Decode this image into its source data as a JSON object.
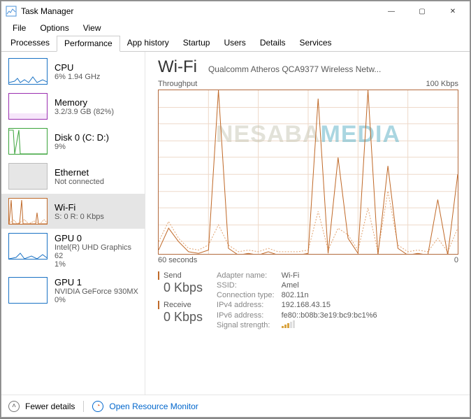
{
  "window": {
    "title": "Task Manager",
    "controls": {
      "min": "—",
      "max": "▢",
      "close": "✕"
    }
  },
  "menu": [
    "File",
    "Options",
    "View"
  ],
  "tabs": [
    "Processes",
    "Performance",
    "App history",
    "Startup",
    "Users",
    "Details",
    "Services"
  ],
  "activeTab": 1,
  "sidebar": [
    {
      "name": "CPU",
      "sub": "6%  1.94 GHz",
      "color": "#1a72c4"
    },
    {
      "name": "Memory",
      "sub": "3.2/3.9 GB (82%)",
      "color": "#9b2fb0"
    },
    {
      "name": "Disk 0 (C: D:)",
      "sub": "9%",
      "color": "#3aa33a"
    },
    {
      "name": "Ethernet",
      "sub": "Not connected",
      "color": "#bdbdbd"
    },
    {
      "name": "Wi-Fi",
      "sub": "S: 0 R: 0 Kbps",
      "color": "#c06a2a",
      "selected": true
    },
    {
      "name": "GPU 0",
      "sub": "Intel(R) UHD Graphics 62\n1%",
      "color": "#1a72c4"
    },
    {
      "name": "GPU 1",
      "sub": "NVIDIA GeForce 930MX\n0%",
      "color": "#1a72c4"
    }
  ],
  "main": {
    "title": "Wi-Fi",
    "adapter": "Qualcomm Atheros QCA9377 Wireless Netw...",
    "graphLabelLeft": "Throughput",
    "graphLabelRight": "100 Kbps",
    "graphFooterLeft": "60 seconds",
    "graphFooterRight": "0",
    "sendLabel": "Send",
    "sendValue": "0 Kbps",
    "recvLabel": "Receive",
    "recvValue": "0 Kbps",
    "props": {
      "adapterNameLabel": "Adapter name:",
      "adapterName": "Wi-Fi",
      "ssidLabel": "SSID:",
      "ssid": "Amel",
      "connTypeLabel": "Connection type:",
      "connType": "802.11n",
      "ipv4Label": "IPv4 address:",
      "ipv4": "192.168.43.15",
      "ipv6Label": "IPv6 address:",
      "ipv6": "fe80::b08b:3e19:bc9:bc1%6",
      "signalLabel": "Signal strength:"
    },
    "watermark1": "NESABA",
    "watermark2": "MEDIA"
  },
  "footer": {
    "fewer": "Fewer details",
    "resmon": "Open Resource Monitor"
  },
  "chart_data": {
    "type": "line",
    "title": "Wi-Fi Throughput",
    "xlabel": "seconds ago",
    "ylabel": "Kbps",
    "ylim": [
      0,
      100
    ],
    "x": [
      60,
      58,
      56,
      54,
      52,
      50,
      48,
      46,
      44,
      42,
      40,
      38,
      36,
      34,
      32,
      30,
      28,
      26,
      24,
      22,
      20,
      18,
      16,
      14,
      12,
      10,
      8,
      6,
      4,
      2,
      0
    ],
    "series": [
      {
        "name": "Send",
        "values": [
          5,
          18,
          10,
          4,
          3,
          5,
          100,
          6,
          2,
          3,
          2,
          4,
          2,
          2,
          2,
          3,
          95,
          3,
          60,
          12,
          3,
          100,
          2,
          55,
          6,
          2,
          3,
          2,
          35,
          2,
          50
        ]
      },
      {
        "name": "Receive",
        "values": [
          10,
          22,
          12,
          6,
          5,
          8,
          20,
          8,
          4,
          5,
          4,
          6,
          4,
          4,
          4,
          5,
          28,
          5,
          18,
          14,
          5,
          30,
          4,
          40,
          8,
          4,
          5,
          4,
          12,
          4,
          18
        ]
      }
    ]
  }
}
